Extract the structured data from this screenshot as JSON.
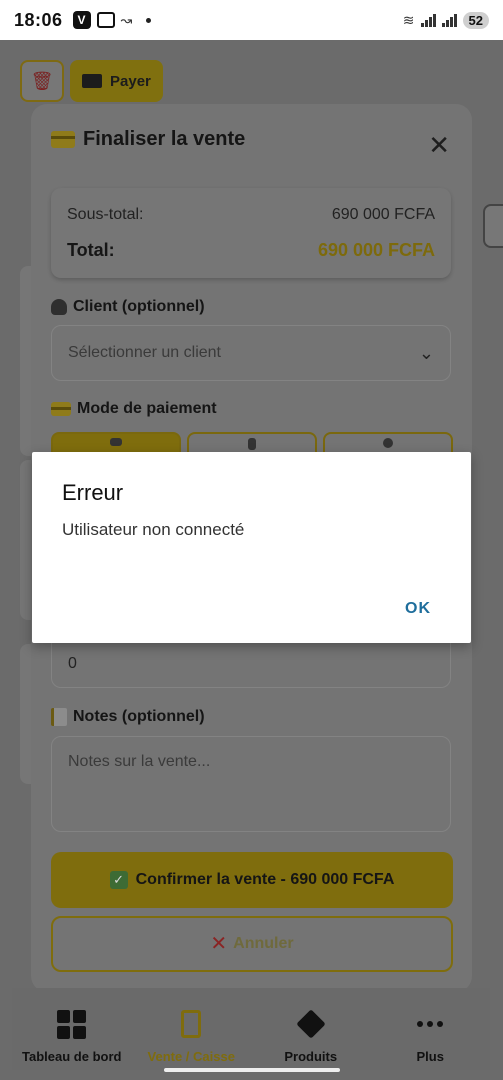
{
  "status_bar": {
    "time": "18:06",
    "v_badge": "V",
    "battery": "52"
  },
  "background": {
    "pay_label": "Payer"
  },
  "modal": {
    "title": "Finaliser la vente",
    "close_symbol": "✕",
    "subtotal_label": "Sous-total:",
    "subtotal_value": "690 000 FCFA",
    "total_label": "Total:",
    "total_value": "690 000 FCFA",
    "client_label": "Client (optionnel)",
    "client_placeholder": "Sélectionner un client",
    "payment_label": "Mode de paiement",
    "amount_value": "0",
    "notes_label": "Notes (optionnel)",
    "notes_placeholder": "Notes sur la vente...",
    "confirm_label": "Confirmer la vente - 690 000 FCFA",
    "cancel_label": "Annuler"
  },
  "dialog": {
    "title": "Erreur",
    "message": "Utilisateur non connecté",
    "ok_label": "OK"
  },
  "bottom_nav": {
    "items": [
      {
        "label": "Tableau de bord",
        "icon": "dashboard-icon"
      },
      {
        "label": "Vente / Caisse",
        "icon": "calculator-icon"
      },
      {
        "label": "Produits",
        "icon": "cube-icon"
      },
      {
        "label": "Plus",
        "icon": "more-icon"
      }
    ]
  },
  "colors": {
    "accent": "#F2C94C",
    "dialog_button": "#1F6E9C"
  }
}
